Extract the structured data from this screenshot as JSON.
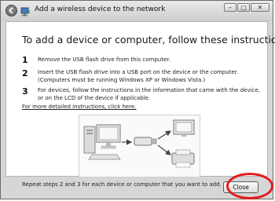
{
  "window": {
    "title": "Add a wireless device to the network",
    "buttons": {
      "minimize": "–",
      "maximize": "□",
      "close": "✕"
    }
  },
  "main": {
    "heading": "To add a device or computer, follow these instructions",
    "steps": [
      {
        "number": "1",
        "text": "Remove the USB flash drive from this computer."
      },
      {
        "number": "2",
        "text": "Insert the USB flash drive into a USB port on the device or the computer. (Computers must be running Windows XP or Windows Vista.)"
      },
      {
        "number": "3",
        "text": "For devices, follow the instructions in the information that came with the device, or on the LCD of the device if applicable."
      }
    ],
    "more_link": "For more detailed instructions, click here.",
    "repeat_text": "Repeat steps 2 and 3 for each device or computer that you want to add."
  },
  "footer": {
    "close_label": "Close"
  },
  "colors": {
    "highlight": "#e51b1b"
  }
}
